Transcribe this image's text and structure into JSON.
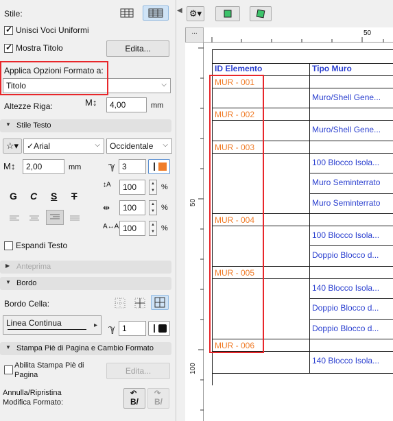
{
  "panel": {
    "stile_label": "Stile:",
    "unisci_label": "Unisci Voci Uniformi",
    "mostra_titolo_label": "Mostra Titolo",
    "edita_label": "Edita...",
    "applica_label": "Applica Opzioni Formato a:",
    "applica_value": "Titolo",
    "altezze_label": "Altezze Riga:",
    "altezze_value": "4,00",
    "altezze_unit": "mm",
    "stile_testo_section": "Stile Testo",
    "font_value": "Arial",
    "script_value": "Occidentale",
    "font_size_value": "2,00",
    "font_size_unit": "mm",
    "pen_value": "3",
    "bold_label": "G",
    "italic_label": "C",
    "underline_label": "S",
    "strike_label": "T",
    "width_factor": "100",
    "spacing_factor": "100",
    "char_spacing": "100",
    "percent": "%",
    "espandi_label": "Espandi Testo",
    "anteprima_section": "Anteprima",
    "bordo_section": "Bordo",
    "bordo_cella_label": "Bordo Cella:",
    "linea_value": "Linea Continua",
    "line_pen_value": "1",
    "stampa_section": "Stampa Piè di Pagina e Cambio Formato",
    "abilita_label_1": "Abilita Stampa Piè di",
    "abilita_label_2": "Pagina",
    "edita2_label": "Edita...",
    "annulla_label_1": "Annulla/Ripristina",
    "annulla_label_2": "Modifica Formato:",
    "undo_text": "B/",
    "redo_text": "B/"
  },
  "ruler": {
    "top_dots": "...",
    "top_50": "50",
    "left_50": "50",
    "left_100": "100"
  },
  "table": {
    "headers": [
      "ID Elemento",
      "Tipo Muro"
    ],
    "ids": [
      "MUR - 001",
      "MUR - 002",
      "MUR - 003",
      "MUR - 004",
      "MUR - 005",
      "MUR - 006"
    ],
    "types": [
      "Muro/Shell Gene...",
      "Muro/Shell Gene...",
      "100 Blocco Isola...",
      "Muro Seminterrato",
      "Muro Seminterrato",
      "100 Blocco Isola...",
      "Doppio Blocco d...",
      "140 Blocco Isola...",
      "Doppio Blocco d...",
      "Doppio Blocco d...",
      "140 Blocco Isola..."
    ]
  },
  "colors": {
    "id_color": "#f07d2a",
    "type_color": "#2a3fcf",
    "header_color": "#2a3fcf",
    "highlight": "#e8262a",
    "pen_color": "#f07d2a"
  }
}
